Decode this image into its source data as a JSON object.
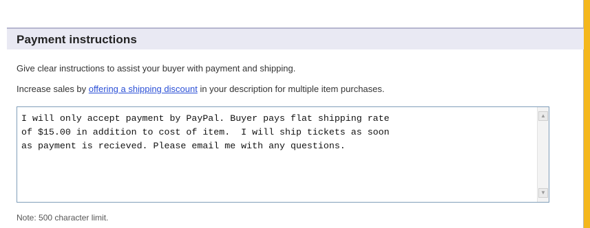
{
  "section": {
    "title": "Payment instructions"
  },
  "help": {
    "line1": "Give clear instructions to assist your buyer with payment and shipping.",
    "line2_prefix": "Increase sales by ",
    "line2_link": "offering a shipping discount",
    "line2_suffix": " in your description for multiple item purchases."
  },
  "instructions": {
    "value": "I will only accept payment by PayPal. Buyer pays flat shipping rate\nof $15.00 in addition to cost of item.  I will ship tickets as soon\nas payment is recieved. Please email me with any questions."
  },
  "scrollbar": {
    "up_icon": "arrow-up-icon",
    "down_icon": "arrow-down-icon"
  },
  "note": {
    "text": "Note: 500 character limit."
  },
  "colors": {
    "header_bg": "#e9e9f3",
    "link": "#2a4fd6",
    "frame": "#f4b71c"
  }
}
